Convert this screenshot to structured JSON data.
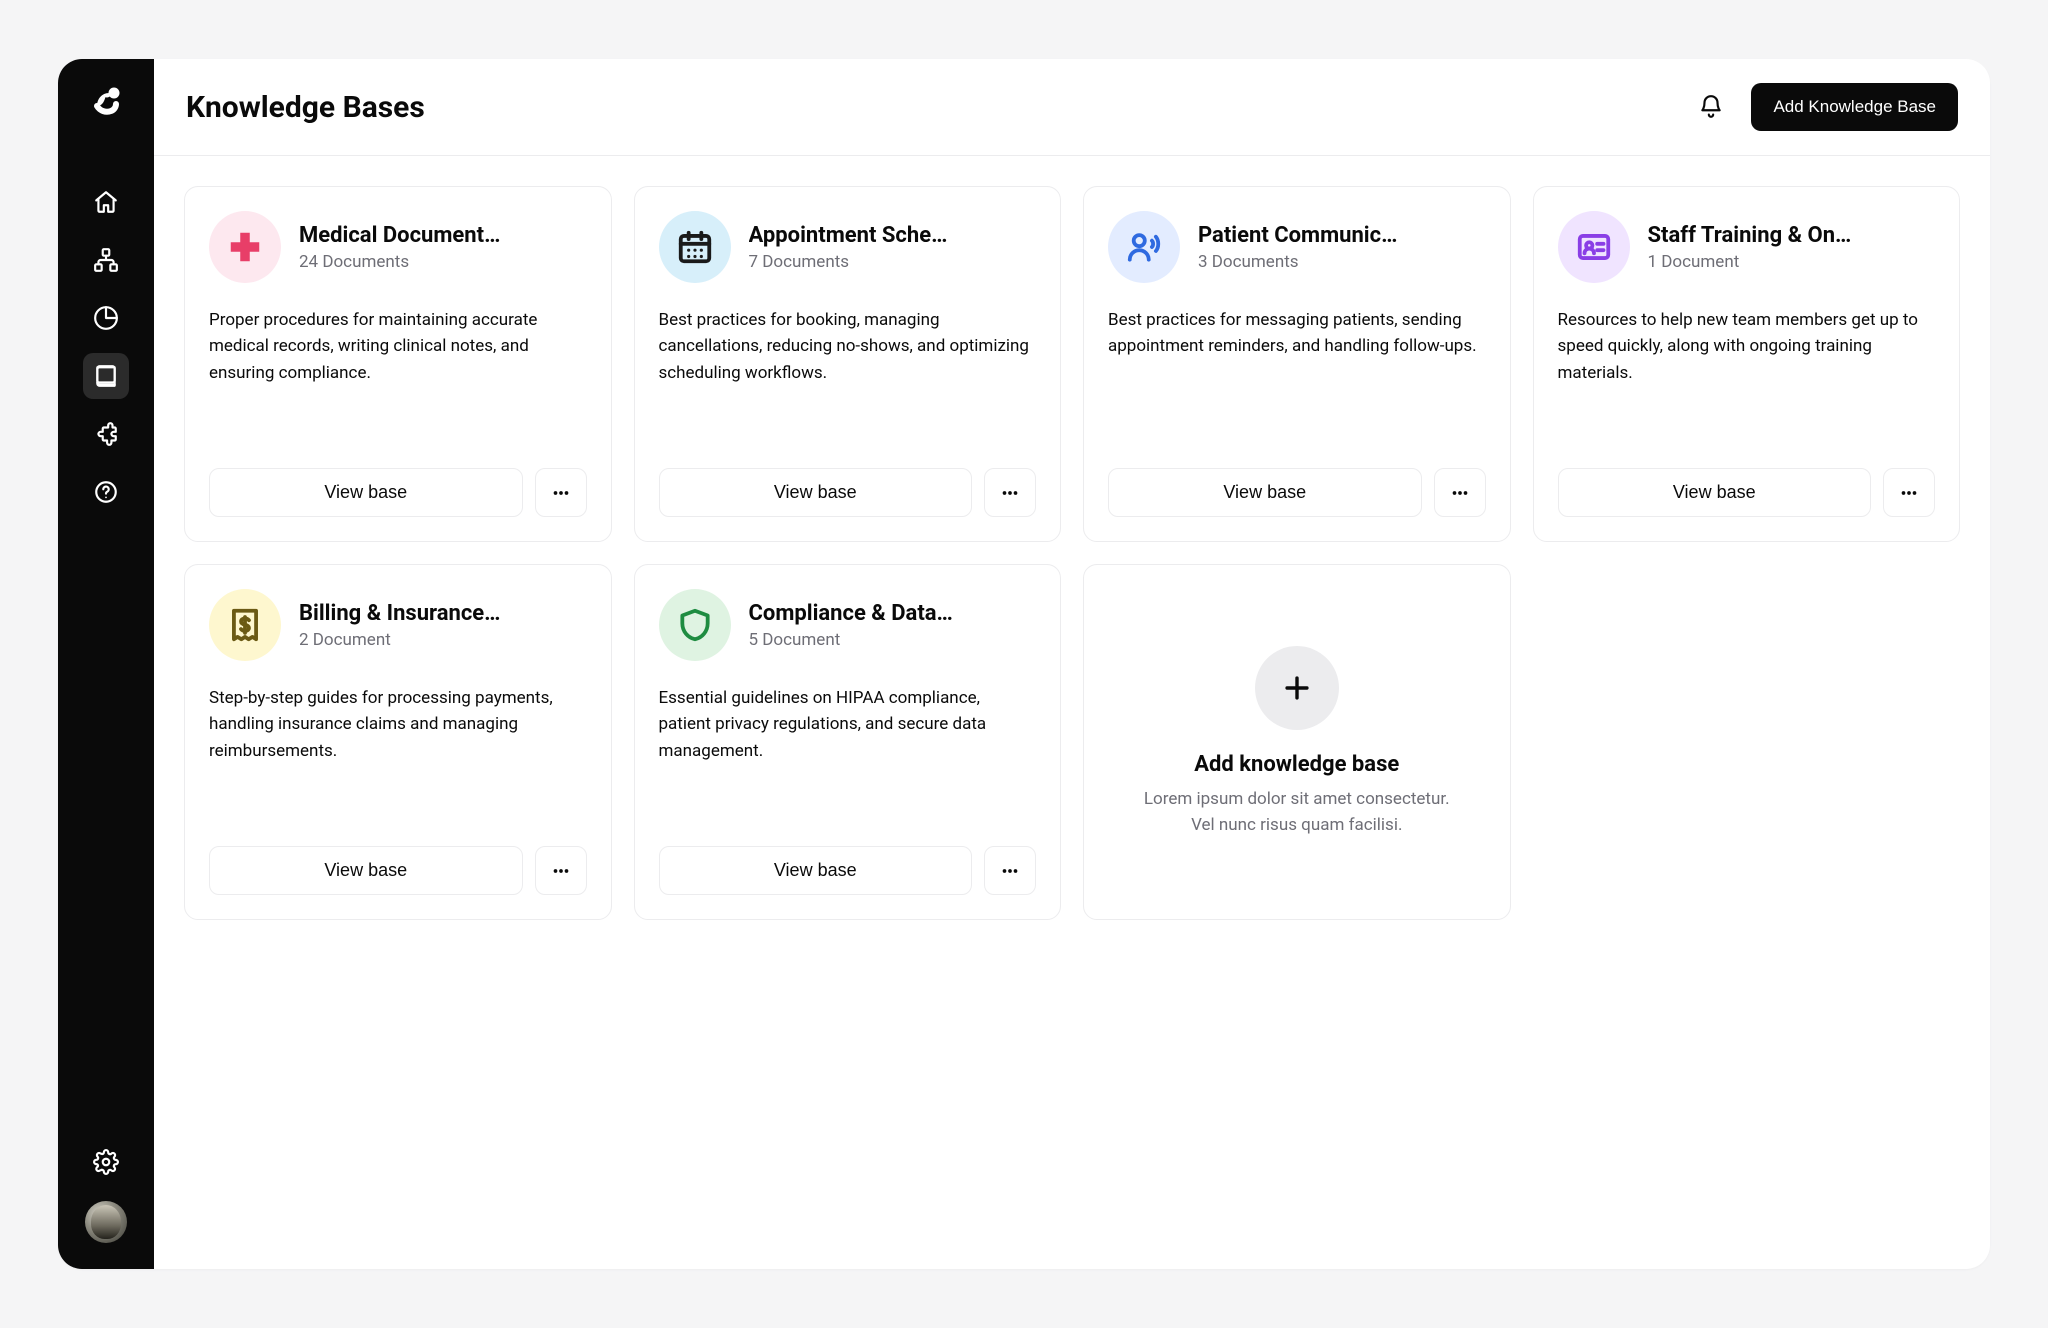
{
  "header": {
    "title": "Knowledge Bases",
    "add_button_label": "Add Knowledge Base"
  },
  "cards": [
    {
      "title": "Medical Document…",
      "subtitle": "24 Documents",
      "description": "Proper procedures for maintaining accurate medical records, writing clinical notes, and ensuring compliance.",
      "view_label": "View base",
      "icon": "plus-medical-icon",
      "bg": "#fde8ef",
      "fg": "#e83e68"
    },
    {
      "title": "Appointment Sche…",
      "subtitle": "7 Documents",
      "description": "Best practices for booking, managing cancellations, reducing no-shows, and optimizing scheduling workflows.",
      "view_label": "View base",
      "icon": "calendar-icon",
      "bg": "#d7effa",
      "fg": "#1a1a1a"
    },
    {
      "title": "Patient Communic…",
      "subtitle": "3 Documents",
      "description": "Best practices for messaging patients, sending appointment reminders, and handling follow-ups.",
      "view_label": "View base",
      "icon": "person-voice-icon",
      "bg": "#e3ecff",
      "fg": "#2f6ae0"
    },
    {
      "title": "Staff Training & On…",
      "subtitle": "1 Document",
      "description": "Resources to help new team members get up to speed quickly, along with ongoing training materials.",
      "view_label": "View base",
      "icon": "id-card-icon",
      "bg": "#f0e4ff",
      "fg": "#8a3ee6"
    },
    {
      "title": "Billing & Insurance…",
      "subtitle": "2 Document",
      "description": "Step-by-step guides for processing payments, handling insurance claims and managing reimbursements.",
      "view_label": "View base",
      "icon": "receipt-dollar-icon",
      "bg": "#fef7cf",
      "fg": "#6b5a14"
    },
    {
      "title": "Compliance & Data…",
      "subtitle": "5 Document",
      "description": "Essential guidelines on HIPAA compliance, patient privacy regulations, and secure data management.",
      "view_label": "View base",
      "icon": "shield-icon",
      "bg": "#dff3e2",
      "fg": "#1e8c41"
    }
  ],
  "add_card": {
    "title": "Add knowledge base",
    "subtitle": "Lorem ipsum dolor sit amet consectetur. Vel nunc risus quam facilisi."
  }
}
